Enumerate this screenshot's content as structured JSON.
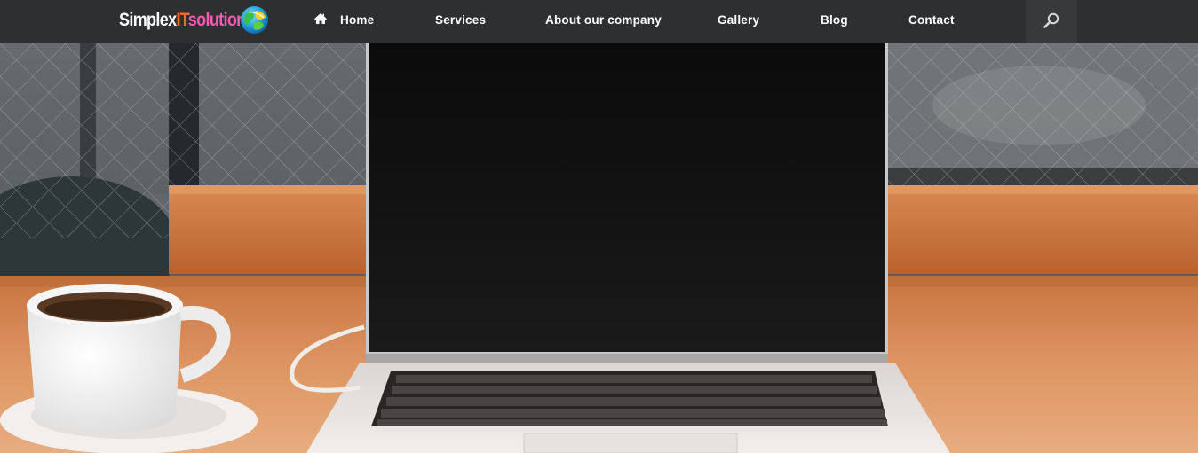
{
  "site": {
    "logo": {
      "part1": "Simplex",
      "part2": "IT",
      "part3": "solutions",
      "icon": "globe-logo-icon"
    }
  },
  "nav": {
    "items": [
      {
        "label": "Home",
        "icon": "home-icon"
      },
      {
        "label": "Services"
      },
      {
        "label": "About our company"
      },
      {
        "label": "Gallery"
      },
      {
        "label": "Blog"
      },
      {
        "label": "Contact"
      }
    ],
    "search_icon": "search-icon"
  },
  "hero": {
    "image": "laptop-and-coffee-cup-on-wooden-table-photo"
  },
  "colors": {
    "navbar_bg": "#2e2f31",
    "search_bg": "#38393b",
    "nav_text": "#ffffff",
    "logo_accent_orange": "#ff6a2c",
    "logo_accent_pink": "#ff59b0"
  }
}
